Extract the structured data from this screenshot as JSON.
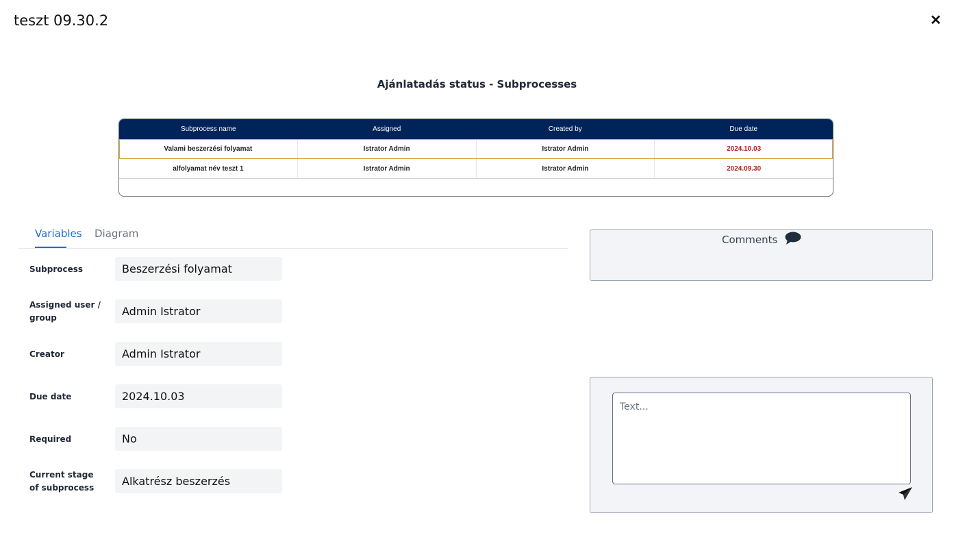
{
  "modal": {
    "title": "teszt 09.30.2",
    "close_icon": "close-icon"
  },
  "subprocesses": {
    "heading": "Ajánlatadás status - Subprocesses",
    "columns": [
      "Subprocess name",
      "Assigned",
      "Created by",
      "Due date"
    ],
    "rows": [
      {
        "name": "Valami beszerzési folyamat",
        "assigned": "Istrator Admin",
        "created_by": "Istrator Admin",
        "due_date": "2024.10.03",
        "selected": true
      },
      {
        "name": "alfolyamat név teszt 1",
        "assigned": "Istrator Admin",
        "created_by": "Istrator Admin",
        "due_date": "2024.09.30",
        "selected": false
      }
    ],
    "header_color": "#00245a",
    "due_date_color": "#b91c1c"
  },
  "tabs": [
    {
      "label": "Variables",
      "active": true
    },
    {
      "label": "Diagram",
      "active": false
    }
  ],
  "fields": [
    {
      "label": "Subprocess",
      "value": "Beszerzési folyamat"
    },
    {
      "label": "Assigned user / group",
      "value": "Admin Istrator"
    },
    {
      "label": "Creator",
      "value": "Admin Istrator"
    },
    {
      "label": "Due date",
      "value": "2024.10.03"
    },
    {
      "label": "Required",
      "value": "No"
    },
    {
      "label": "Current stage of subprocess",
      "value": "Alkatrész beszerzés"
    }
  ],
  "comments": {
    "title": "Comments",
    "icon": "comment-bubble-icon"
  },
  "compose": {
    "placeholder": "Text...",
    "send_icon": "send-icon"
  },
  "accent_color": "#1d6bd1"
}
